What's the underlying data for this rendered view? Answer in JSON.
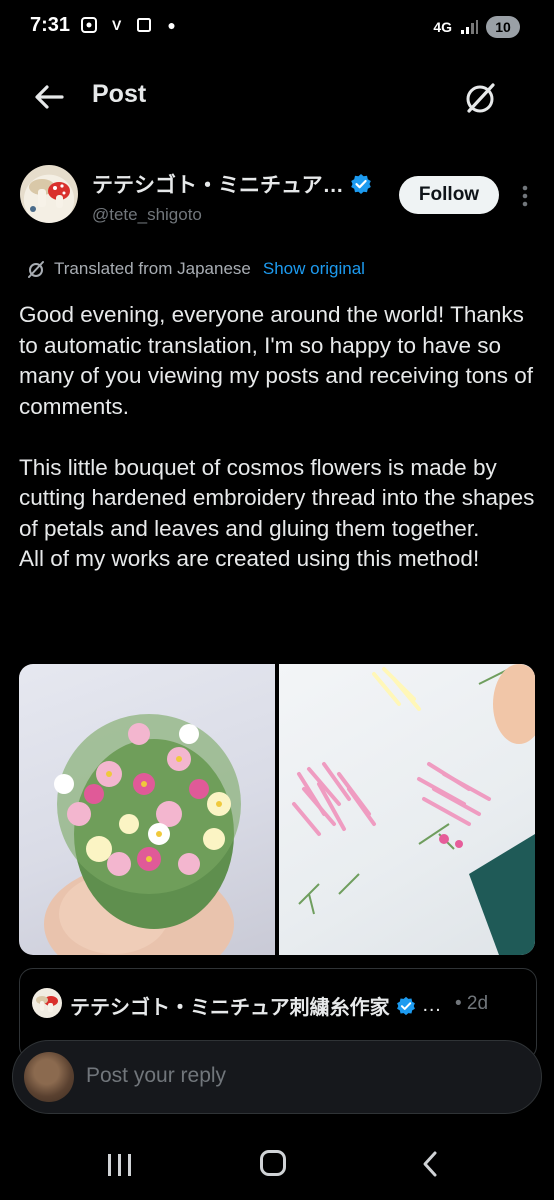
{
  "status_bar": {
    "time": "7:31",
    "left_icons": [
      "screenshot-icon",
      "v-icon",
      "square-icon",
      "dot-icon"
    ],
    "network": "4G",
    "battery": "10"
  },
  "header": {
    "title": "Post",
    "back_icon": "arrow-left-icon",
    "grok_icon": "grok-icon"
  },
  "author": {
    "name": "テテシゴト・ミニチュア…",
    "handle": "@tete_shigoto",
    "verified": true,
    "follow_label": "Follow"
  },
  "translation": {
    "label": "Translated from Japanese",
    "show_original": "Show original"
  },
  "post": {
    "text": "Good evening, everyone around the world! Thanks to automatic translation, I'm so happy to have so many of you viewing my posts and receiving tons of comments.\n\nThis little bouquet of cosmos flowers is made by cutting hardened embroidery thread into the shapes of petals and leaves and gluing them together.\nAll of my works are created using this method!"
  },
  "quote": {
    "name": "テテシゴト・ミニチュア刺繍糸作家",
    "more": "…",
    "age": "• 2d"
  },
  "reply": {
    "placeholder": "Post your reply"
  },
  "colors": {
    "background": "#000000",
    "text": "#e7e9ea",
    "muted": "#71767b",
    "link": "#1d9bf0",
    "verified": "#1d9bf0"
  }
}
